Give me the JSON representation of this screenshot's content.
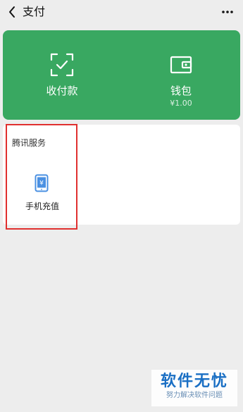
{
  "header": {
    "title": "支付"
  },
  "pay_card": {
    "receive": {
      "label": "收付款"
    },
    "wallet": {
      "label": "钱包",
      "balance": "¥1.00"
    }
  },
  "services": {
    "section_title": "腾讯服务",
    "items": [
      {
        "label": "手机充值"
      }
    ]
  },
  "watermark": {
    "title": "软件无忧",
    "subtitle": "努力解决软件问题"
  },
  "colors": {
    "pay_card_green": "#39a861",
    "highlight_red": "#e0302f",
    "icon_blue": "#4a90e2",
    "watermark_blue": "#1a6fc4"
  }
}
